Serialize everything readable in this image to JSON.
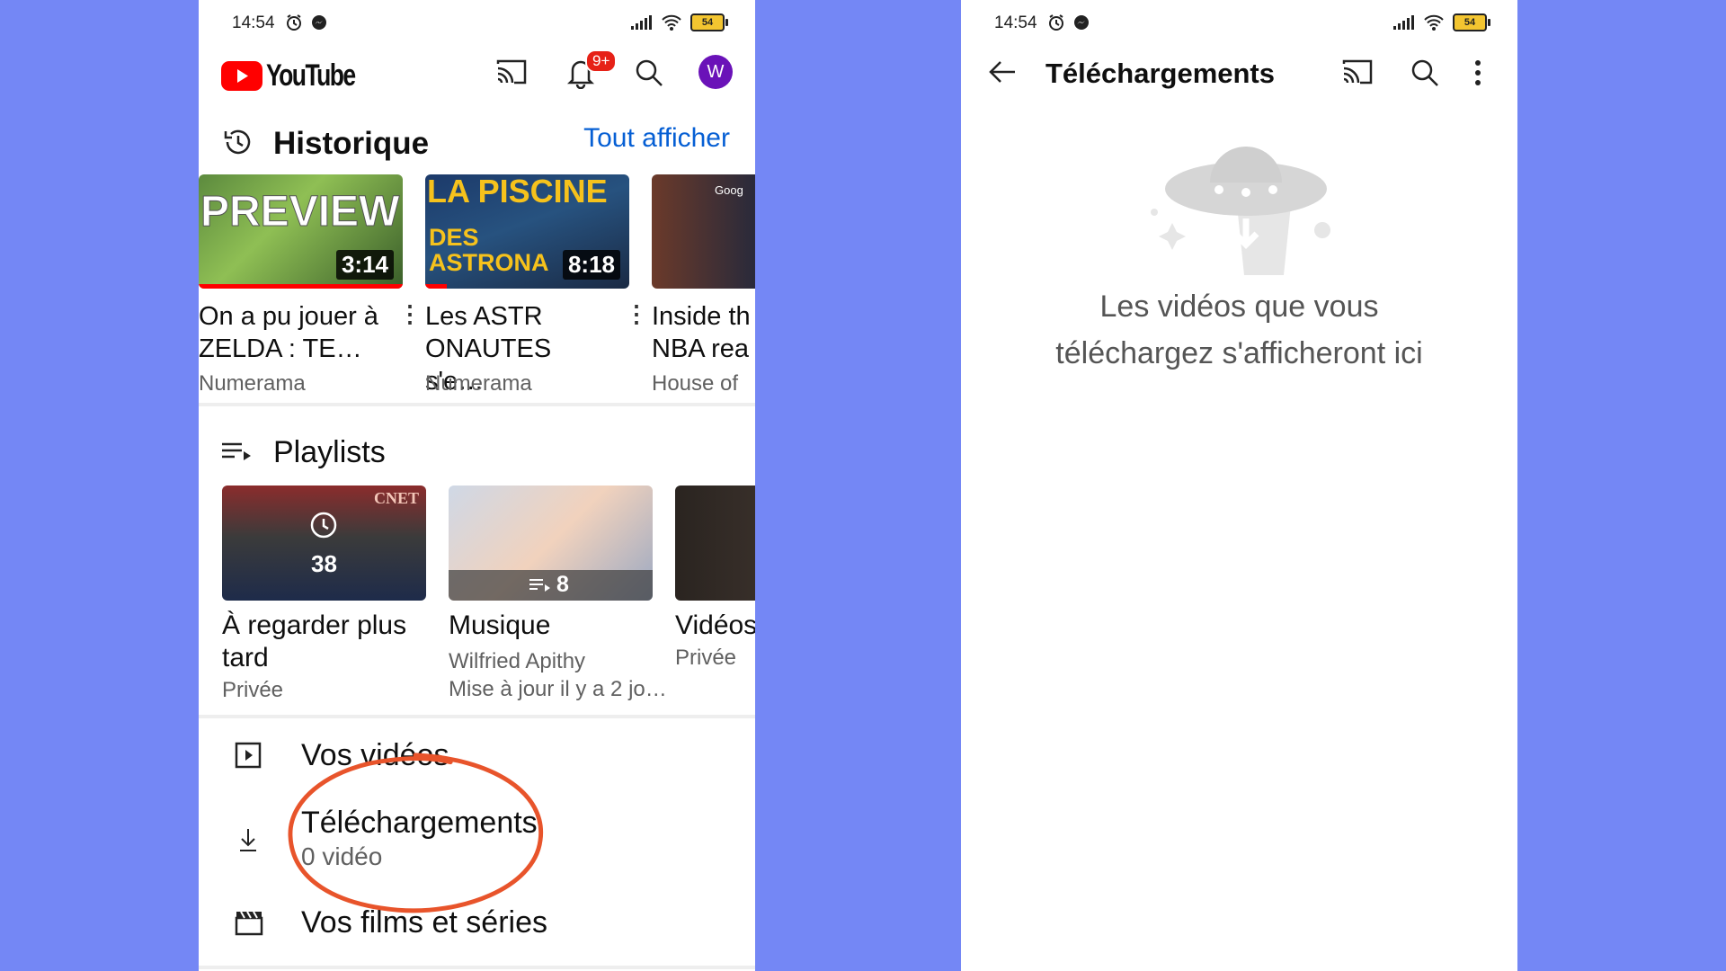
{
  "left": {
    "status": {
      "time": "14:54",
      "battery": "54"
    },
    "header": {
      "logo": "YouTube",
      "notif_badge": "9+",
      "avatar_letter": "W"
    },
    "history": {
      "title": "Historique",
      "see_all": "Tout afficher",
      "videos": [
        {
          "thumb_text": "PREVIEW",
          "duration": "3:14",
          "title": "On a pu jouer à ZELDA : TE…",
          "channel": "Numerama"
        },
        {
          "thumb_text": "LA PISCINE",
          "thumb_text2": "DES ASTRONA",
          "duration": "8:18",
          "title": "Les ASTR ONAUTES s'e…",
          "channel": "Numerama"
        },
        {
          "thumb_text": "Goog",
          "title": "Inside th NBA rea",
          "channel": "House of"
        }
      ]
    },
    "playlists": {
      "title": "Playlists",
      "items": [
        {
          "count": "38",
          "thumb_text": "CNET",
          "title": "À regarder plus tard",
          "sub1": "Privée",
          "sub2": ""
        },
        {
          "count": "8",
          "title": "Musique",
          "sub1": "Wilfried Apithy",
          "sub2": "Mise à jour il y a 2 jo…"
        },
        {
          "title": "Vidéos",
          "sub1": "Privée"
        }
      ]
    },
    "menu": {
      "your_videos": "Vos vidéos",
      "downloads": "Téléchargements",
      "downloads_sub": "0 vidéo",
      "movies": "Vos films et séries"
    }
  },
  "right": {
    "status": {
      "time": "14:54",
      "battery": "54"
    },
    "header_title": "Téléchargements",
    "empty_line1": "Les vidéos que vous",
    "empty_line2": "téléchargez s'afficheront ici"
  },
  "colors": {
    "background": "#7487f5",
    "youtube_red": "#ff0000",
    "link_blue": "#065fd4",
    "highlight_circle": "#e8542b",
    "avatar": "#6a12b8"
  }
}
